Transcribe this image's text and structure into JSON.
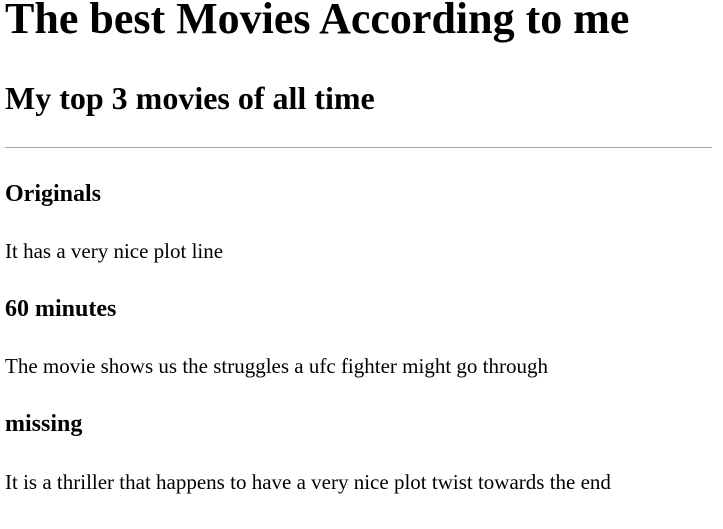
{
  "page": {
    "title": "The best Movies According to me",
    "subtitle": "My top 3 movies of all time"
  },
  "movies": [
    {
      "name": "Originals",
      "description": "It has a very nice plot line"
    },
    {
      "name": "60 minutes",
      "description": "The movie shows us the struggles a ufc fighter might go through"
    },
    {
      "name": "missing",
      "description": "It is a thriller that happens to have a very nice plot twist towards the end"
    }
  ]
}
